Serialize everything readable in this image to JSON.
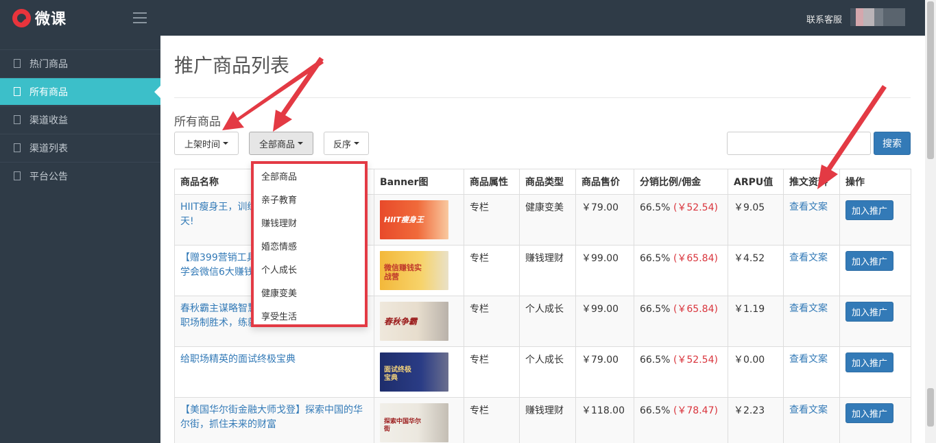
{
  "header": {
    "logo_text": "微课",
    "contact_label": "联系客服"
  },
  "sidebar": {
    "items": [
      {
        "label": "热门商品",
        "active": false
      },
      {
        "label": "所有商品",
        "active": true
      },
      {
        "label": "渠道收益",
        "active": false
      },
      {
        "label": "渠道列表",
        "active": false
      },
      {
        "label": "平台公告",
        "active": false
      }
    ]
  },
  "main": {
    "page_title": "推广商品列表",
    "section_title": "所有商品",
    "filters": {
      "sort_label": "上架时间",
      "category_label": "全部商品",
      "order_label": "反序"
    },
    "search": {
      "placeholder": "",
      "button_label": "搜索"
    }
  },
  "dropdown": {
    "items": [
      "全部商品",
      "亲子教育",
      "赚钱理财",
      "婚恋情感",
      "个人成长",
      "健康变美",
      "享受生活"
    ]
  },
  "table": {
    "headers": [
      "商品名称",
      "Banner图",
      "商品属性",
      "商品类型",
      "商品售价",
      "分销比例/佣金",
      "ARPU值",
      "推文资料",
      "操作"
    ],
    "rows": [
      {
        "name": "HIIT瘦身王，训练",
        "name2": "天!",
        "banner_text": "HIIT瘦身王",
        "attr": "专栏",
        "type": "健康变美",
        "price": "￥79.00",
        "ratio": "66.5%",
        "commission": "(￥52.54)",
        "arpu": "￥9.05",
        "doc": "查看文案",
        "action": "加入推广"
      },
      {
        "name": "【赠399营销工具",
        "name2": "学会微信6大赚钱",
        "banner_text": "微信赚钱实战营",
        "attr": "专栏",
        "type": "赚钱理财",
        "price": "￥99.00",
        "ratio": "66.5%",
        "commission": "(￥65.84)",
        "arpu": "￥4.52",
        "doc": "查看文案",
        "action": "加入推广"
      },
      {
        "name": "春秋霸主谋略智慧",
        "name2": "职场制胜术，练就",
        "banner_text": "春秋争霸",
        "attr": "专栏",
        "type": "个人成长",
        "price": "￥99.00",
        "ratio": "66.5%",
        "commission": "(￥65.84)",
        "arpu": "￥1.19",
        "doc": "查看文案",
        "action": "加入推广"
      },
      {
        "name": "给职场精英的面试终极宝典",
        "name2": "",
        "banner_text": "面试终极宝典",
        "attr": "专栏",
        "type": "个人成长",
        "price": "￥79.00",
        "ratio": "66.5%",
        "commission": "(￥52.54)",
        "arpu": "￥0.00",
        "doc": "查看文案",
        "action": "加入推广"
      },
      {
        "name": "【美国华尔街金融大师戈登】探索中国的华",
        "name2": "尔街，抓住未来的财富",
        "banner_text": "探索中国华尔街",
        "attr": "专栏",
        "type": "赚钱理财",
        "price": "￥118.00",
        "ratio": "66.5%",
        "commission": "(￥78.47)",
        "arpu": "￥2.23",
        "doc": "查看文案",
        "action": "加入推广"
      }
    ]
  }
}
